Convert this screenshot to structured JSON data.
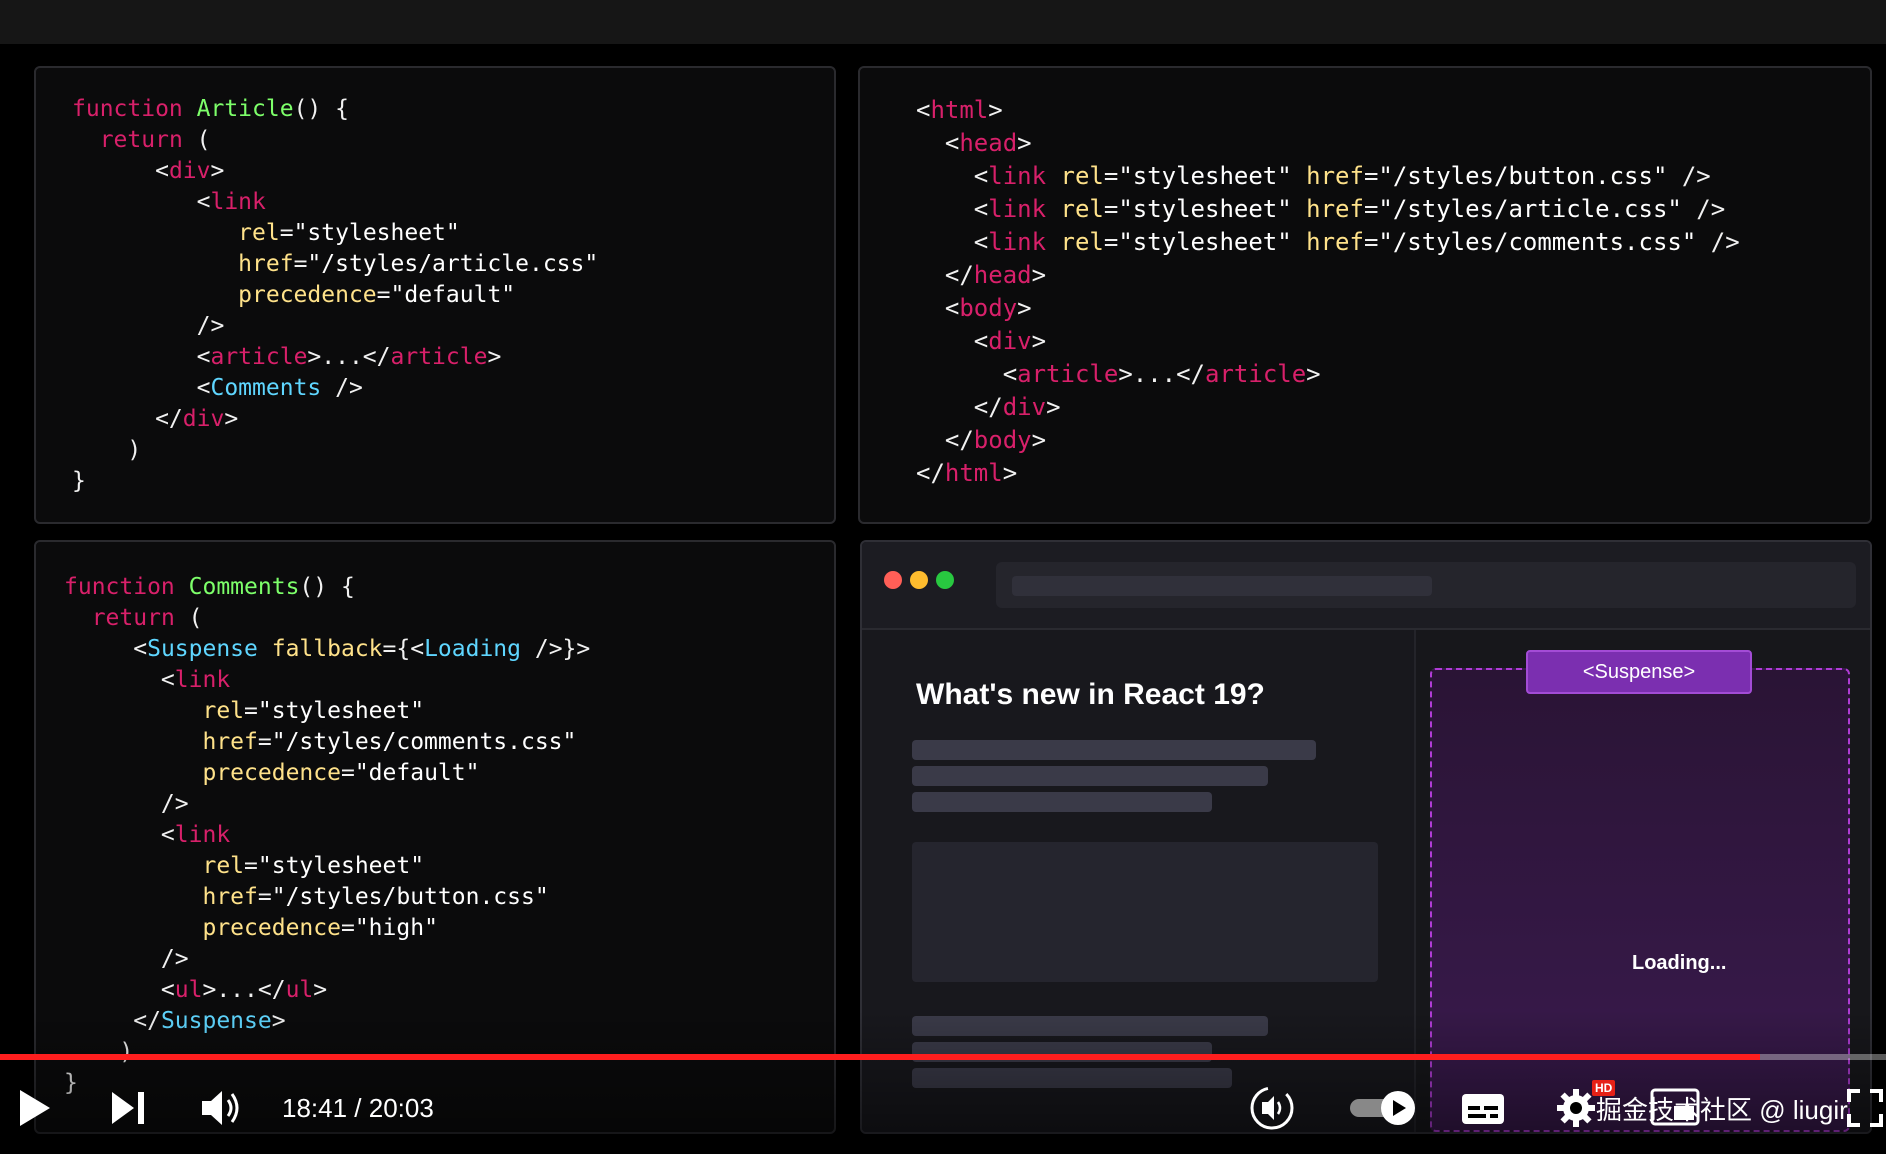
{
  "code": {
    "article": [
      [
        [
          "function",
          "kw"
        ],
        [
          " ",
          ""
        ],
        [
          "Article",
          "fn"
        ],
        [
          "() {",
          ""
        ]
      ],
      [
        [
          "  ",
          ""
        ],
        [
          "return",
          "kw"
        ],
        [
          " (",
          ""
        ]
      ],
      [
        [
          "      <",
          ""
        ],
        [
          "div",
          "tg"
        ],
        [
          ">",
          ""
        ]
      ],
      [
        [
          "         <",
          ""
        ],
        [
          "link",
          "tg"
        ]
      ],
      [
        [
          "            ",
          ""
        ],
        [
          "rel",
          "at"
        ],
        [
          "=",
          ""
        ],
        [
          "\"stylesheet\"",
          "st"
        ]
      ],
      [
        [
          "            ",
          ""
        ],
        [
          "href",
          "at"
        ],
        [
          "=",
          ""
        ],
        [
          "\"/styles/article.css\"",
          "st"
        ]
      ],
      [
        [
          "            ",
          ""
        ],
        [
          "precedence",
          "at"
        ],
        [
          "=",
          ""
        ],
        [
          "\"default\"",
          "st"
        ]
      ],
      [
        [
          "         />",
          ""
        ]
      ],
      [
        [
          "         <",
          ""
        ],
        [
          "article",
          "tg"
        ],
        [
          ">...</",
          ""
        ],
        [
          "article",
          "tg"
        ],
        [
          ">",
          ""
        ]
      ],
      [
        [
          "         <",
          ""
        ],
        [
          "Comments",
          "cp"
        ],
        [
          " />",
          ""
        ]
      ],
      [
        [
          "      </",
          ""
        ],
        [
          "div",
          "tg"
        ],
        [
          ">",
          ""
        ]
      ],
      [
        [
          "    )",
          ""
        ]
      ],
      [
        [
          "}",
          ""
        ]
      ]
    ],
    "html": [
      [
        [
          "<",
          ""
        ],
        [
          "html",
          "tg"
        ],
        [
          ">",
          ""
        ]
      ],
      [
        [
          "  <",
          ""
        ],
        [
          "head",
          "tg"
        ],
        [
          ">",
          ""
        ]
      ],
      [
        [
          "    <",
          ""
        ],
        [
          "link",
          "tg"
        ],
        [
          " ",
          ""
        ],
        [
          "rel",
          "at"
        ],
        [
          "=",
          ""
        ],
        [
          "\"stylesheet\"",
          "st"
        ],
        [
          " ",
          ""
        ],
        [
          "href",
          "at"
        ],
        [
          "=",
          ""
        ],
        [
          "\"/styles/button.css\"",
          "st"
        ],
        [
          " />",
          ""
        ]
      ],
      [
        [
          "    <",
          ""
        ],
        [
          "link",
          "tg"
        ],
        [
          " ",
          ""
        ],
        [
          "rel",
          "at"
        ],
        [
          "=",
          ""
        ],
        [
          "\"stylesheet\"",
          "st"
        ],
        [
          " ",
          ""
        ],
        [
          "href",
          "at"
        ],
        [
          "=",
          ""
        ],
        [
          "\"/styles/article.css\"",
          "st"
        ],
        [
          " />",
          ""
        ]
      ],
      [
        [
          "    <",
          ""
        ],
        [
          "link",
          "tg"
        ],
        [
          " ",
          ""
        ],
        [
          "rel",
          "at"
        ],
        [
          "=",
          ""
        ],
        [
          "\"stylesheet\"",
          "st"
        ],
        [
          " ",
          ""
        ],
        [
          "href",
          "at"
        ],
        [
          "=",
          ""
        ],
        [
          "\"/styles/comments.css\"",
          "st"
        ],
        [
          " />",
          ""
        ]
      ],
      [
        [
          "  </",
          ""
        ],
        [
          "head",
          "tg"
        ],
        [
          ">",
          ""
        ]
      ],
      [
        [
          "  <",
          ""
        ],
        [
          "body",
          "tg"
        ],
        [
          ">",
          ""
        ]
      ],
      [
        [
          "    <",
          ""
        ],
        [
          "div",
          "tg"
        ],
        [
          ">",
          ""
        ]
      ],
      [
        [
          "      <",
          ""
        ],
        [
          "article",
          "tg"
        ],
        [
          ">...</",
          ""
        ],
        [
          "article",
          "tg"
        ],
        [
          ">",
          ""
        ]
      ],
      [
        [
          "    </",
          ""
        ],
        [
          "div",
          "tg"
        ],
        [
          ">",
          ""
        ]
      ],
      [
        [
          "  </",
          ""
        ],
        [
          "body",
          "tg"
        ],
        [
          ">",
          ""
        ]
      ],
      [
        [
          "</",
          ""
        ],
        [
          "html",
          "tg"
        ],
        [
          ">",
          ""
        ]
      ]
    ],
    "comments": [
      [
        [
          "function",
          "kw"
        ],
        [
          " ",
          ""
        ],
        [
          "Comments",
          "fn"
        ],
        [
          "() {",
          ""
        ]
      ],
      [
        [
          "  ",
          ""
        ],
        [
          "return",
          "kw"
        ],
        [
          " (",
          ""
        ]
      ],
      [
        [
          "     <",
          ""
        ],
        [
          "Suspense",
          "cp"
        ],
        [
          " ",
          ""
        ],
        [
          "fallback",
          "at"
        ],
        [
          "={<",
          ""
        ],
        [
          "Loading",
          "cp"
        ],
        [
          " />}>",
          ""
        ]
      ],
      [
        [
          "       <",
          ""
        ],
        [
          "link",
          "tg"
        ]
      ],
      [
        [
          "          ",
          ""
        ],
        [
          "rel",
          "at"
        ],
        [
          "=",
          ""
        ],
        [
          "\"stylesheet\"",
          "st"
        ]
      ],
      [
        [
          "          ",
          ""
        ],
        [
          "href",
          "at"
        ],
        [
          "=",
          ""
        ],
        [
          "\"/styles/comments.css\"",
          "st"
        ]
      ],
      [
        [
          "          ",
          ""
        ],
        [
          "precedence",
          "at"
        ],
        [
          "=",
          ""
        ],
        [
          "\"default\"",
          "st"
        ]
      ],
      [
        [
          "       />",
          ""
        ]
      ],
      [
        [
          "       <",
          ""
        ],
        [
          "link",
          "tg"
        ]
      ],
      [
        [
          "          ",
          ""
        ],
        [
          "rel",
          "at"
        ],
        [
          "=",
          ""
        ],
        [
          "\"stylesheet\"",
          "st"
        ]
      ],
      [
        [
          "          ",
          ""
        ],
        [
          "href",
          "at"
        ],
        [
          "=",
          ""
        ],
        [
          "\"/styles/button.css\"",
          "st"
        ]
      ],
      [
        [
          "          ",
          ""
        ],
        [
          "precedence",
          "at"
        ],
        [
          "=",
          ""
        ],
        [
          "\"high\"",
          "st"
        ]
      ],
      [
        [
          "       />",
          ""
        ]
      ],
      [
        [
          "       <",
          ""
        ],
        [
          "ul",
          "tg"
        ],
        [
          ">...</",
          ""
        ],
        [
          "ul",
          "tg"
        ],
        [
          ">",
          ""
        ]
      ],
      [
        [
          "     </",
          ""
        ],
        [
          "Suspense",
          "cp"
        ],
        [
          ">",
          ""
        ]
      ],
      [
        [
          "    )",
          ""
        ]
      ],
      [
        [
          "}",
          ""
        ]
      ]
    ]
  },
  "browser": {
    "heading": "What's new in React 19?",
    "suspense_tag": "<Suspense>",
    "loading_text": "Loading...",
    "traffic_lights": [
      "#ff5f57",
      "#febc2e",
      "#28c840"
    ]
  },
  "player": {
    "time_current": "18:41",
    "time_separator": " / ",
    "time_total": "20:03",
    "progress_fraction": 0.933,
    "hd_badge": "HD",
    "watermark": "掘金技术社区 @ liugir"
  },
  "icons": [
    "play-icon",
    "next-icon",
    "volume-icon",
    "speed-icon",
    "autoplay-toggle-icon",
    "captions-icon",
    "settings-icon",
    "miniplayer-icon",
    "fullscreen-icon"
  ]
}
